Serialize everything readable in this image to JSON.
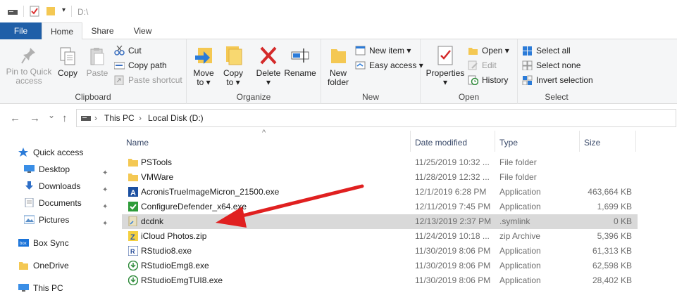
{
  "titlebar": {
    "path": "D:\\"
  },
  "tabs": [
    {
      "label": "File"
    },
    {
      "label": "Home"
    },
    {
      "label": "Share"
    },
    {
      "label": "View"
    }
  ],
  "ribbon": {
    "clipboard": {
      "label": "Clipboard",
      "pin_line1": "Pin to Quick",
      "pin_line2": "access",
      "copy": "Copy",
      "paste": "Paste",
      "cut": "Cut",
      "copy_path": "Copy path",
      "paste_shortcut": "Paste shortcut"
    },
    "organize": {
      "label": "Organize",
      "move_line1": "Move",
      "move_line2": "to ▾",
      "copy_line1": "Copy",
      "copy_line2": "to ▾",
      "delete": "Delete",
      "delete_arrow": "▾",
      "rename": "Rename"
    },
    "new": {
      "label": "New",
      "folder_line1": "New",
      "folder_line2": "folder",
      "new_item": "New item ▾",
      "easy_access": "Easy access ▾"
    },
    "open": {
      "label": "Open",
      "properties": "Properties",
      "properties_arrow": "▾",
      "open": "Open ▾",
      "edit": "Edit",
      "history": "History"
    },
    "select": {
      "label": "Select",
      "select_all": "Select all",
      "select_none": "Select none",
      "invert": "Invert selection"
    }
  },
  "address": {
    "back": "←",
    "forward": "→",
    "recent": "⌄",
    "up": "↑",
    "sep": "›",
    "crumbs": [
      "This PC",
      "Local Disk (D:)"
    ]
  },
  "navpane": [
    {
      "label": "Quick access",
      "icon": "star-icon",
      "color": "#2b7bd8"
    },
    {
      "label": "Desktop",
      "icon": "desktop-icon",
      "color": "#3a8ee6",
      "pinned": true
    },
    {
      "label": "Downloads",
      "icon": "download-icon",
      "color": "#2f6fc7",
      "pinned": true
    },
    {
      "label": "Documents",
      "icon": "document-icon",
      "color": "#8a9ab0",
      "pinned": true
    },
    {
      "label": "Pictures",
      "icon": "pictures-icon",
      "color": "#5a8fc9",
      "pinned": true
    },
    {
      "label": "Box Sync",
      "icon": "box-icon",
      "color": "#1a73d9"
    },
    {
      "label": "OneDrive",
      "icon": "folder-icon",
      "color": "#f4c853"
    },
    {
      "label": "This PC",
      "icon": "computer-icon",
      "color": "#3a8ee6"
    }
  ],
  "columns": {
    "name": "Name",
    "date": "Date modified",
    "type": "Type",
    "size": "Size",
    "sort_glyph": "^"
  },
  "files": [
    {
      "name": "PSTools",
      "date": "11/25/2019 10:32 ...",
      "type": "File folder",
      "size": "",
      "icon": "folder-icon",
      "color": "#f4c853"
    },
    {
      "name": "VMWare",
      "date": "11/28/2019 12:32 ...",
      "type": "File folder",
      "size": "",
      "icon": "folder-icon",
      "color": "#f4c853"
    },
    {
      "name": "AcronisTrueImageMicron_21500.exe",
      "date": "12/1/2019 6:28 PM",
      "type": "Application",
      "size": "463,664 KB",
      "icon": "acronis-icon",
      "color": "#1b4fa0"
    },
    {
      "name": "ConfigureDefender_x64.exe",
      "date": "12/11/2019 7:45 PM",
      "type": "Application",
      "size": "1,699 KB",
      "icon": "defender-icon",
      "color": "#2e9c3a"
    },
    {
      "name": "dcdnk",
      "date": "12/13/2019 2:37 PM",
      "type": ".symlink",
      "size": "0 KB",
      "icon": "symlink-icon",
      "color": "#e8e0c0",
      "selected": true
    },
    {
      "name": "iCloud Photos.zip",
      "date": "11/24/2019 10:18 ...",
      "type": "zip Archive",
      "size": "5,396 KB",
      "icon": "zip-icon",
      "color": "#2a5db0"
    },
    {
      "name": "RStudio8.exe",
      "date": "11/30/2019 8:06 PM",
      "type": "Application",
      "size": "61,313 KB",
      "icon": "rstudio-icon",
      "color": "#2a4f9a"
    },
    {
      "name": "RStudioEmg8.exe",
      "date": "11/30/2019 8:06 PM",
      "type": "Application",
      "size": "62,598 KB",
      "icon": "rstudio-emg-icon",
      "color": "#2e8a3a"
    },
    {
      "name": "RStudioEmgTUI8.exe",
      "date": "11/30/2019 8:06 PM",
      "type": "Application",
      "size": "28,402 KB",
      "icon": "rstudio-emg-icon",
      "color": "#2e8a3a"
    }
  ],
  "annotation": {
    "color": "#e02020"
  }
}
